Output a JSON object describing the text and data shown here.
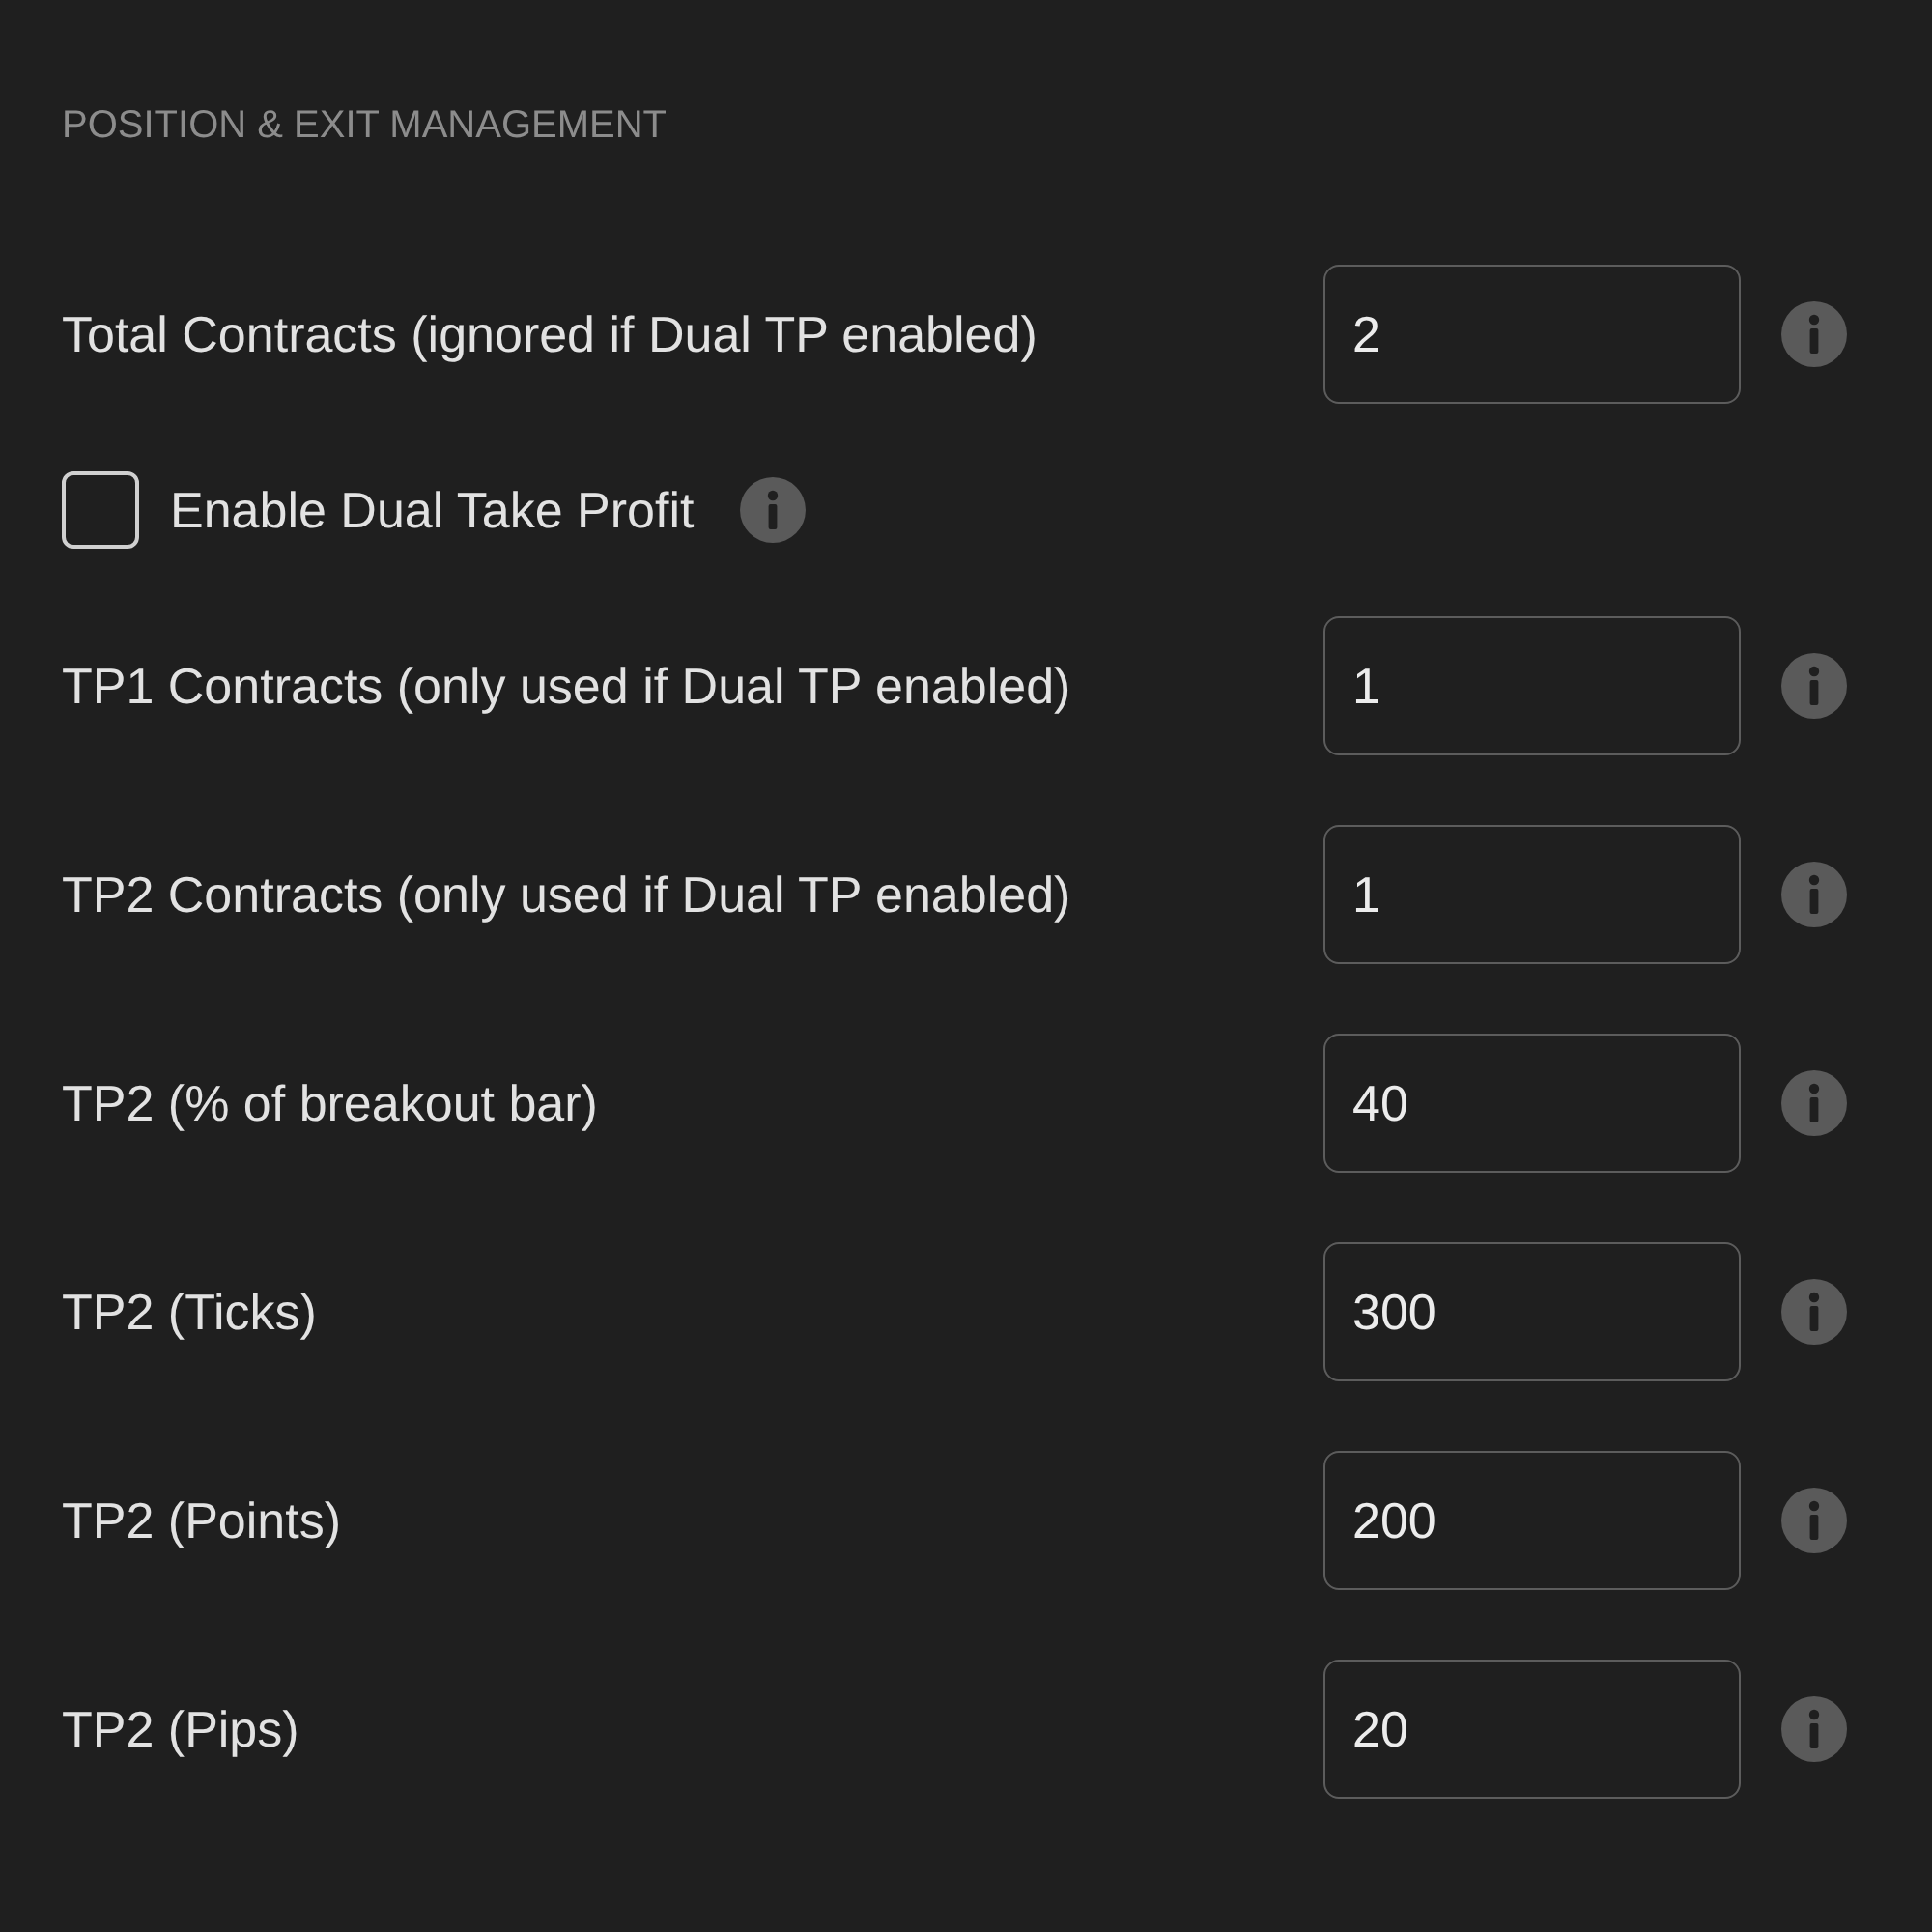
{
  "section_title": "POSITION & EXIT MANAGEMENT",
  "fields": [
    {
      "kind": "number",
      "label": "Total Contracts (ignored if Dual TP enabled)",
      "value": "2"
    },
    {
      "kind": "checkbox",
      "label": "Enable Dual Take Profit",
      "checked": false
    },
    {
      "kind": "number",
      "label": "TP1 Contracts (only used if Dual TP enabled)",
      "value": "1"
    },
    {
      "kind": "number",
      "label": "TP2 Contracts (only used if Dual TP enabled)",
      "value": "1"
    },
    {
      "kind": "number",
      "label": "TP2 (% of breakout bar)",
      "value": "40"
    },
    {
      "kind": "number",
      "label": "TP2 (Ticks)",
      "value": "300"
    },
    {
      "kind": "number",
      "label": "TP2 (Points)",
      "value": "200"
    },
    {
      "kind": "number",
      "label": "TP2 (Pips)",
      "value": "20"
    }
  ]
}
